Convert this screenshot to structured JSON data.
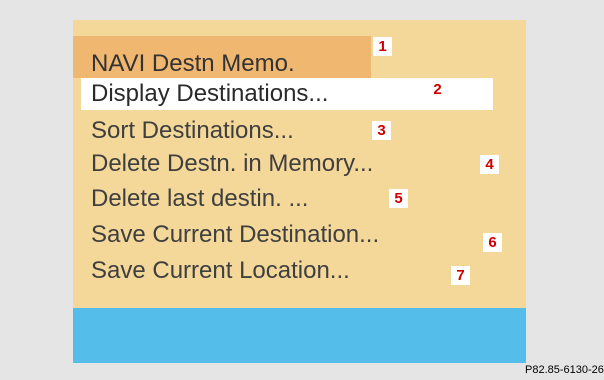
{
  "menu": {
    "title": "NAVI Destn Memo.",
    "items": [
      {
        "label": "Display Destinations...",
        "selected": true
      },
      {
        "label": "Sort Destinations..."
      },
      {
        "label": "Delete Destn. in Memory..."
      },
      {
        "label": "Delete last destin. ..."
      },
      {
        "label": "Save Current Destination..."
      },
      {
        "label": "Save Current Location..."
      }
    ]
  },
  "callouts": [
    "1",
    "2",
    "3",
    "4",
    "5",
    "6",
    "7"
  ],
  "figure_ref": "P82.85-6130-26",
  "colors": {
    "background": "#e5e5e5",
    "screen": "#f3d899",
    "title_bar": "#f0b770",
    "highlight": "#ffffff",
    "bottom_band": "#55bdea",
    "callout_text": "#cc0000"
  }
}
